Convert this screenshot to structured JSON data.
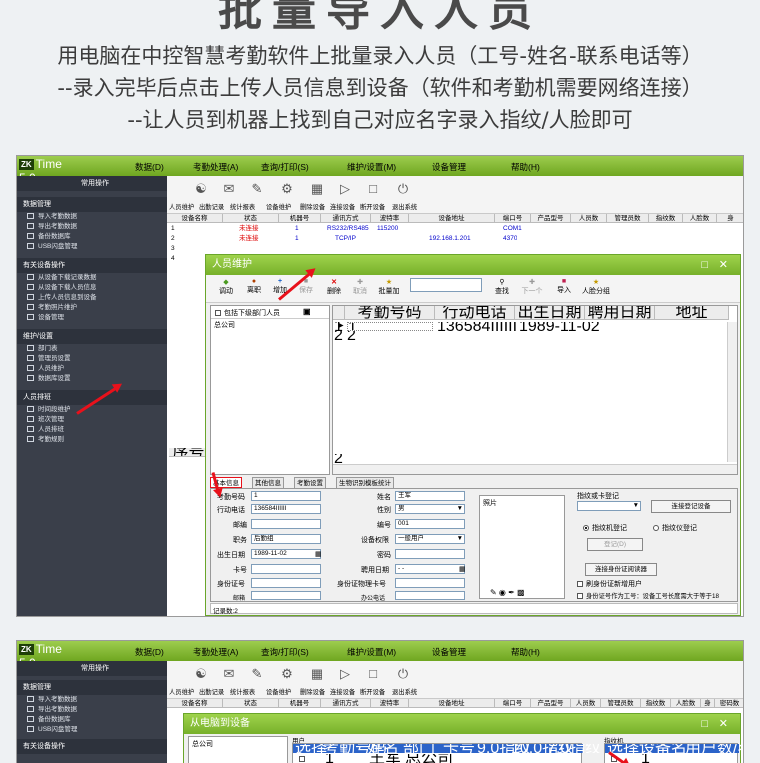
{
  "header": {
    "title": "批量导入人员",
    "intro_lines": [
      "用电脑在中控智慧考勤软件上批量录入人员（工号-姓名-联系电话等）",
      "--录入完毕后点击上传人员信息到设备（软件和考勤机需要网络连接）",
      "--让人员到机器上找到自己对应名字录入指纹/人脸即可"
    ]
  },
  "app": {
    "logo_text": "Time 5.0",
    "logo_badge": "ZK",
    "menus": [
      "数据(D)",
      "考勤处理(A)",
      "查询/打印(S)",
      "维护/设置(M)",
      "设备管理",
      "帮助(H)"
    ],
    "colors": {
      "accent": "#77b02a",
      "sidebar": "#3a3f4a",
      "arrow": "#e8111b"
    }
  },
  "sidebar": {
    "sections": [
      {
        "title": "常用操作",
        "items": []
      },
      {
        "title": "数据管理",
        "items": [
          "导入考勤数据",
          "导出考勤数据",
          "备份数据库",
          "USB闪盘管理"
        ]
      },
      {
        "title": "有关设备操作",
        "items": [
          "从设备下载记录数据",
          "从设备下载人员信息",
          "上传人员信息到设备",
          "考勤照片维护",
          "设备管理"
        ]
      },
      {
        "title": "维护/设置",
        "items": [
          "部门表",
          "管理员设置",
          "人员维护",
          "数据库设置"
        ]
      },
      {
        "title": "人员排班",
        "items": [
          "时间段维护",
          "班次管理",
          "人员排班",
          "考勤规则"
        ]
      }
    ]
  },
  "toolbar": {
    "labels": [
      "人员维护",
      "出勤记录",
      "统计报表",
      "设备维护",
      "删除设备",
      "连接设备",
      "断开设备",
      "退出系统"
    ]
  },
  "device_grid": {
    "columns": [
      "设备名称",
      "状态",
      "机器号",
      "通讯方式",
      "波特率",
      "设备地址",
      "端口号",
      "产品型号",
      "人员数",
      "管理员数",
      "指纹数",
      "人脸数",
      "身"
    ],
    "rows": [
      {
        "name": "1",
        "status": "未连接",
        "id": "1",
        "comm": "RS232/RS485",
        "baud": "115200",
        "addr": "",
        "port": "COM1"
      },
      {
        "name": "2",
        "status": "未连接",
        "id": "1",
        "comm": "TCP/IP",
        "baud": "",
        "addr": "192.168.1.201",
        "port": "4370"
      },
      {
        "name": "3"
      },
      {
        "name": "4"
      }
    ],
    "bottom_col": "序号"
  },
  "dialog": {
    "title": "人员维护",
    "toolbar": [
      "调动",
      "离职",
      "增加",
      "保存",
      "删除",
      "取消",
      "批量加",
      "查找",
      "下一个",
      "导入",
      "人脸分组"
    ],
    "include_sub_label": "包括下级部门人员",
    "dept_tree": [
      "总公司"
    ],
    "list_columns": [
      "考勤号码",
      "行动电话",
      "出生日期",
      "聘用日期",
      "地址"
    ],
    "list_rows": [
      {
        "no": "1",
        "num": "1",
        "phone": "136584IIIIII",
        "birth": "1989-11-02"
      },
      {
        "no": "2",
        "num": "2",
        "phone": "",
        "birth": ""
      }
    ],
    "scroll_index": "2",
    "tabs": [
      "基本信息",
      "其他信息",
      "考勤设置",
      "生物识别模板统计"
    ],
    "fields": {
      "attendance_no": {
        "label": "考勤号码",
        "value": "1"
      },
      "mobile": {
        "label": "行动电话",
        "value": "136584IIIIII"
      },
      "postcode": {
        "label": "邮编",
        "value": ""
      },
      "position": {
        "label": "职务",
        "value": "后勤组"
      },
      "birth": {
        "label": "出生日期",
        "value": "1989-11-02"
      },
      "card": {
        "label": "卡号",
        "value": ""
      },
      "id_no": {
        "label": "身份证号",
        "value": ""
      },
      "mail": {
        "label": "邮箱",
        "value": ""
      },
      "home": {
        "label": "家庭住址",
        "value": ""
      },
      "name": {
        "label": "姓名",
        "value": "王军"
      },
      "gender": {
        "label": "性别",
        "value": "男"
      },
      "number": {
        "label": "编号",
        "value": "001"
      },
      "privilege": {
        "label": "设备权限",
        "value": "一般用户"
      },
      "password": {
        "label": "密码",
        "value": ""
      },
      "hire": {
        "label": "聘用日期",
        "value": "- -"
      },
      "id_phys": {
        "label": "身份证物理卡号",
        "value": ""
      },
      "office": {
        "label": "办公电话",
        "value": ""
      }
    },
    "photo_label": "照片",
    "enroll": {
      "title": "指纹或卡登记",
      "connect_btn": "连接登记设备",
      "opt_fp_machine": "指纹机登记",
      "opt_fp_reader": "指纹仪登记",
      "register_btn": "登记(D)",
      "id_reader_btn": "连接身份证阅读器",
      "swipe_id": "刷身份证新增用户",
      "use_id_as_no": "身份证号作为工号：设备工号长度需大于等于18"
    },
    "record_count": "记录数:2"
  },
  "bottom": {
    "toolbar_labels": [
      "人员维护",
      "出勤记录",
      "统计报表",
      "设备维护",
      "删除设备",
      "连接设备",
      "断开设备",
      "退出系统"
    ],
    "grid_columns": [
      "设备名称",
      "状态",
      "机器号",
      "通讯方式",
      "波特率",
      "设备地址",
      "端口号",
      "产品型号",
      "人员数",
      "管理员数",
      "指纹数",
      "人脸数",
      "身",
      "密码数"
    ],
    "dialog_title": "从电脑到设备",
    "dept": "总公司",
    "user_group": "用户",
    "user_columns": [
      "选择",
      "考勤号码",
      "姓名",
      "部门",
      "卡号",
      "9.0指纹",
      "10.0指纹",
      "7.0指纹"
    ],
    "user_row": {
      "num": "1",
      "name": "王军",
      "dept": "总公司"
    },
    "device_group": "指纹机",
    "device_columns": [
      "选择",
      "设备名",
      "用户数/容量"
    ],
    "device_row": {
      "name": "1"
    },
    "sidebar_sections": [
      "常用操作",
      "数据管理",
      "有关设备操作"
    ],
    "sidebar_items": [
      "导入考勤数据",
      "导出考勤数据",
      "备份数据库",
      "USB闪盘管理"
    ]
  }
}
